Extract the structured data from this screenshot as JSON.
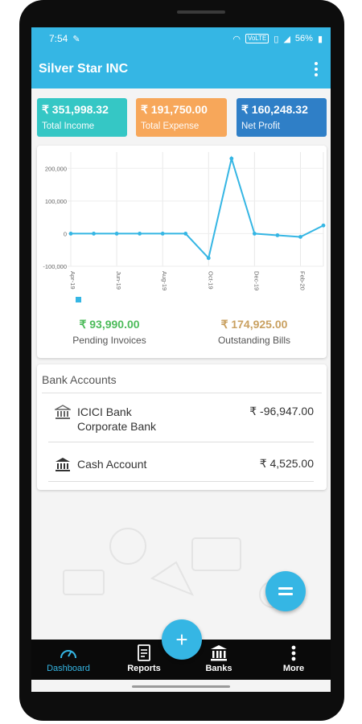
{
  "status_bar": {
    "time": "7:54",
    "volte": "VoLTE",
    "battery": "56%"
  },
  "app_bar": {
    "title": "Silver Star INC",
    "menu_icon": "more-vert-icon"
  },
  "summary": {
    "income": {
      "amount": "₹ 351,998.32",
      "label": "Total Income",
      "color": "#35c7c5"
    },
    "expense": {
      "amount": "₹ 191,750.00",
      "label": "Total Expense",
      "color": "#f7a75a"
    },
    "profit": {
      "amount": "₹ 160,248.32",
      "label": "Net Profit",
      "color": "#2f7fc7"
    }
  },
  "chart_data": {
    "type": "line",
    "x": [
      "Apr-19",
      "",
      "Jun-19",
      "",
      "Aug-19",
      "",
      "Oct-19",
      "",
      "Dec-19",
      "",
      "Feb-20",
      ""
    ],
    "series": [
      {
        "values": [
          0,
          0,
          0,
          0,
          0,
          0,
          -75000,
          230000,
          0,
          -5000,
          -10000,
          25000
        ]
      }
    ],
    "y_ticks": [
      "200,000",
      "100,000",
      "0",
      "-100,000"
    ],
    "ylim": [
      -100000,
      250000
    ],
    "grid": true,
    "line_color": "#35b6e4"
  },
  "pending": {
    "value": "₹ 93,990.00",
    "label": "Pending Invoices"
  },
  "outstanding": {
    "value": "₹ 174,925.00",
    "label": "Outstanding Bills"
  },
  "bank": {
    "heading": "Bank Accounts",
    "accounts": [
      {
        "name_line1": "ICICI Bank",
        "name_line2": "Corporate Bank",
        "amount": "₹ -96,947.00",
        "icon": "bank-icon"
      },
      {
        "name_line1": "Cash Account",
        "amount": "₹ 4,525.00",
        "icon": "bank-icon"
      }
    ]
  },
  "nav": {
    "items": [
      {
        "label": "Dashboard",
        "icon": "speedometer-icon",
        "active": true
      },
      {
        "label": "Reports",
        "icon": "report-icon"
      },
      {
        "label": "Banks",
        "icon": "bank-icon"
      },
      {
        "label": "More",
        "icon": "more-vert-icon"
      }
    ]
  },
  "fab": {
    "add": "+",
    "calc": "calculator-icon"
  }
}
